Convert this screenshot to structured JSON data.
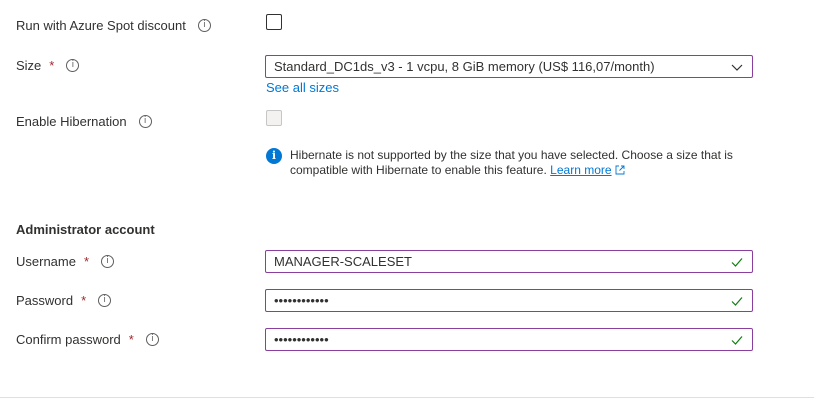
{
  "spot": {
    "label": "Run with Azure Spot discount",
    "checked": false
  },
  "size": {
    "label": "Size",
    "required_mark": "*",
    "selected": "Standard_DC1ds_v3 - 1 vcpu, 8 GiB memory (US$ 116,07/month)",
    "see_all_link": "See all sizes"
  },
  "hibernation": {
    "label": "Enable Hibernation",
    "checked": false,
    "disabled": true,
    "notice_text": "Hibernate is not supported by the size that you have selected. Choose a size that is compatible with Hibernate to enable this feature.",
    "learn_more": "Learn more"
  },
  "admin": {
    "section_title": "Administrator account",
    "username": {
      "label": "Username",
      "required_mark": "*",
      "value": "MANAGER-SCALESET",
      "valid": true
    },
    "password": {
      "label": "Password",
      "required_mark": "*",
      "value": "••••••••••••",
      "valid": true
    },
    "confirm_password": {
      "label": "Confirm password",
      "required_mark": "*",
      "value": "••••••••••••",
      "valid": true
    }
  },
  "icons": {
    "info": "info-circle-icon",
    "chevron": "chevron-down-icon",
    "check": "checkmark-icon",
    "external": "external-link-icon"
  },
  "colors": {
    "focus_border": "#8a3f9e",
    "link": "#0078d4",
    "required": "#a4262c",
    "valid": "#107c10"
  }
}
